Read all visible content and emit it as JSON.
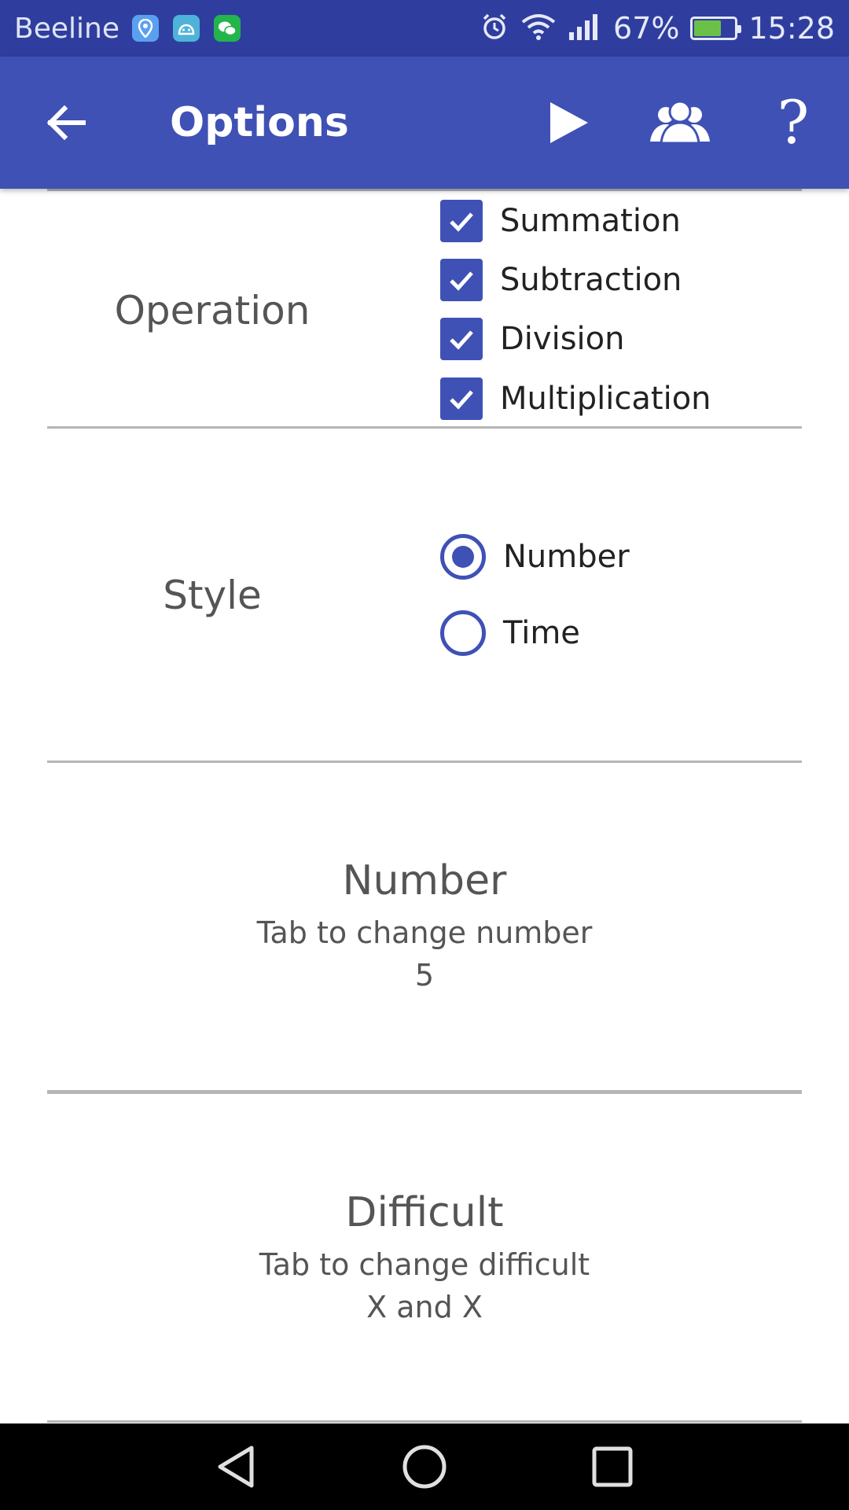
{
  "status_bar": {
    "carrier": "Beeline",
    "battery_percent": "67%",
    "battery_level": 0.67,
    "time": "15:28",
    "notification_icons": [
      "maps-icon",
      "android-icon",
      "wechat-icon"
    ],
    "system_icons": [
      "alarm-icon",
      "wifi-icon",
      "signal-icon",
      "battery-charging-icon"
    ]
  },
  "app_bar": {
    "title": "Options",
    "actions": [
      "back-arrow-icon",
      "play-icon",
      "players-icon",
      "help-icon"
    ],
    "help_glyph": "?",
    "color": "#3f51b5"
  },
  "operation": {
    "label": "Operation",
    "options": [
      {
        "label": "Summation",
        "checked": true
      },
      {
        "label": "Subtraction",
        "checked": true
      },
      {
        "label": "Division",
        "checked": true
      },
      {
        "label": "Multiplication",
        "checked": true
      }
    ]
  },
  "style": {
    "label": "Style",
    "options": [
      {
        "label": "Number",
        "selected": true
      },
      {
        "label": "Time",
        "selected": false
      }
    ]
  },
  "number": {
    "title": "Number",
    "subtitle": "Tab to change number",
    "value": "5"
  },
  "difficult": {
    "title": "Difficult",
    "subtitle": "Tab to change difficult",
    "value": "X and X"
  },
  "nav_bar": {
    "buttons": [
      "nav-back-icon",
      "nav-home-icon",
      "nav-recents-icon"
    ]
  },
  "colors": {
    "accent": "#3f51b5",
    "status_bar": "#2f3e9e",
    "divider": "#b6b6b6"
  }
}
